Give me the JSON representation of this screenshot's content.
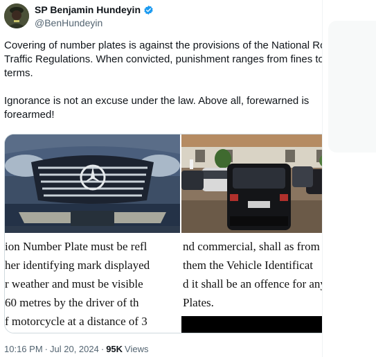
{
  "author": {
    "name": "SP Benjamin Hundeyin",
    "handle": "@BenHundeyin",
    "verified": true,
    "badge_color": "#1d9bf0"
  },
  "tweet": {
    "paragraphs": [
      "Covering of number plates is against the provisions of the National Road Traffic Regulations. When convicted, punishment ranges from fines to prison terms.",
      "Ignorance is not an excuse under the law. Above all, forewarned is forearmed!"
    ]
  },
  "media": {
    "left_text_lines": [
      "ion Number Plate must be refl",
      "her identifying mark displayed",
      "r weather and must be visible",
      " 60 metres by the driver of th",
      "f motorcycle at a distance of 3"
    ],
    "right_text_lines": [
      "nd commercial, shall as from",
      " them the Vehicle Identificat",
      "d it shall be an offence for any",
      "Plates."
    ]
  },
  "meta": {
    "time": "10:16 PM",
    "separator": "·",
    "date": "Jul 20, 2024",
    "views_count": "95K",
    "views_label": "Views"
  },
  "icons": {
    "more": "more-horizontal-icon",
    "verified": "verified-badge-icon"
  }
}
